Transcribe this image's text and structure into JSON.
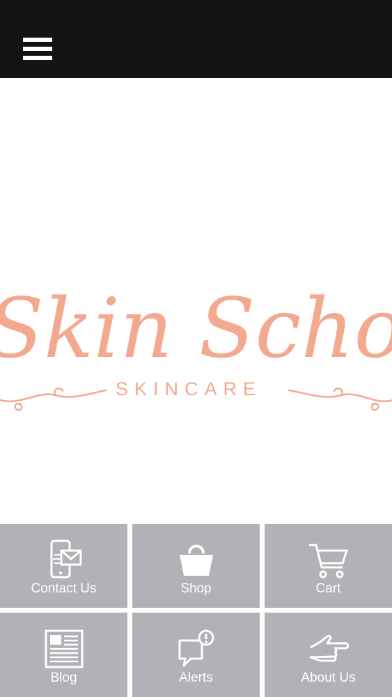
{
  "header": {
    "menu_icon": "hamburger-menu-icon",
    "background_color": "#141214"
  },
  "logo": {
    "script_text": "Skin Scholars",
    "subtitle": "SKINCARE",
    "color": "#f3a98f"
  },
  "nav_tiles": [
    {
      "label": "Contact Us",
      "icon": "phone-mail-icon"
    },
    {
      "label": "Shop",
      "icon": "shopping-bag-icon"
    },
    {
      "label": "Cart",
      "icon": "shopping-cart-icon"
    },
    {
      "label": "Blog",
      "icon": "newspaper-icon"
    },
    {
      "label": "Alerts",
      "icon": "alert-bubble-icon"
    },
    {
      "label": "About Us",
      "icon": "pointing-hand-icon"
    }
  ],
  "colors": {
    "tile_background": "#b2b1b5",
    "tile_text": "#ffffff"
  }
}
